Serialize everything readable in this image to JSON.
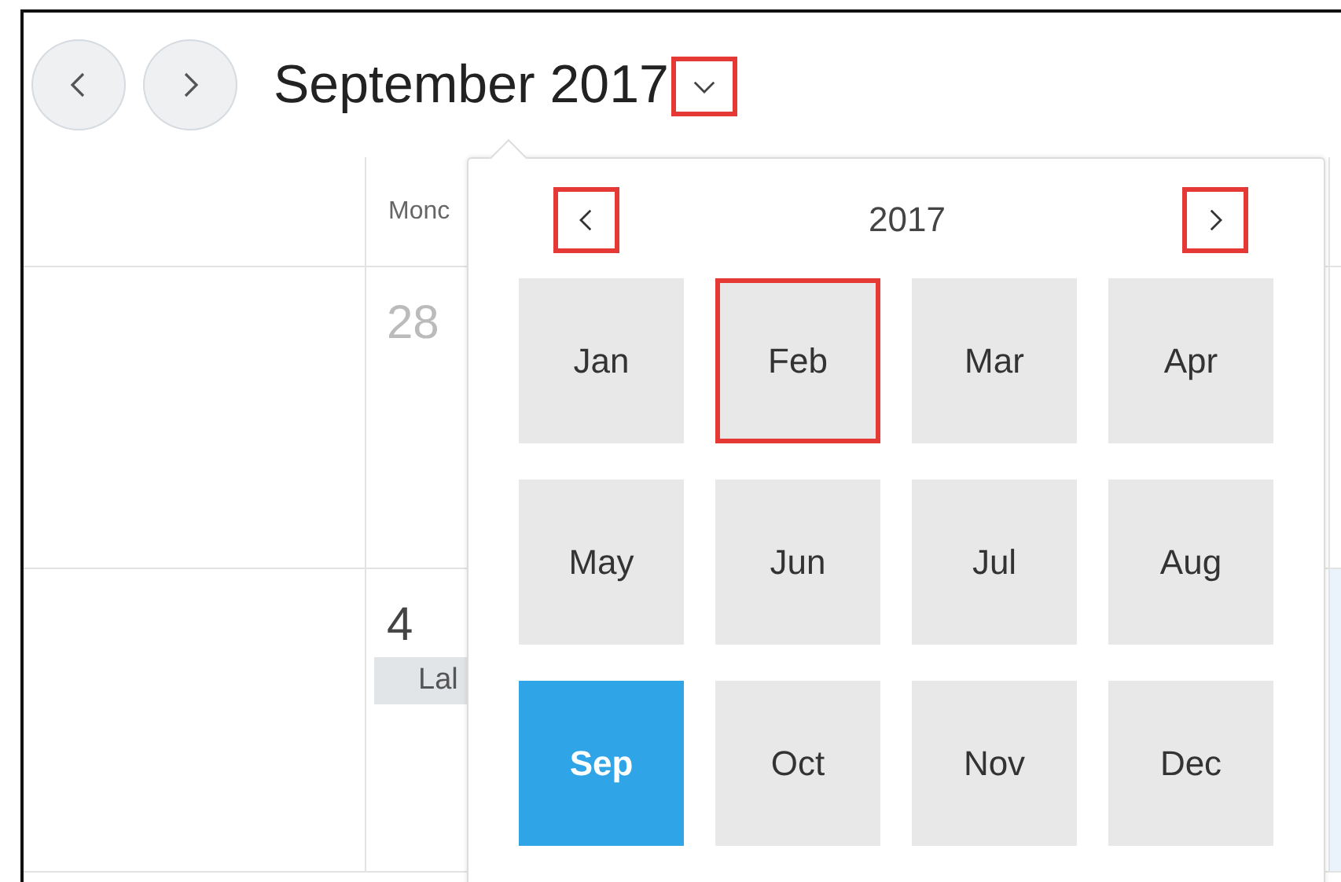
{
  "header": {
    "title": "September 2017",
    "dropdown_highlighted": true
  },
  "calendar": {
    "columns": [
      "Monc"
    ],
    "rows": [
      {
        "day": "28",
        "muted": true,
        "events": []
      },
      {
        "day": "4",
        "muted": false,
        "events": [
          "Lal"
        ]
      }
    ]
  },
  "month_picker": {
    "year": "2017",
    "prev_highlighted": true,
    "next_highlighted": true,
    "months": [
      {
        "label": "Jan",
        "selected": false,
        "highlighted": false
      },
      {
        "label": "Feb",
        "selected": false,
        "highlighted": true
      },
      {
        "label": "Mar",
        "selected": false,
        "highlighted": false
      },
      {
        "label": "Apr",
        "selected": false,
        "highlighted": false
      },
      {
        "label": "May",
        "selected": false,
        "highlighted": false
      },
      {
        "label": "Jun",
        "selected": false,
        "highlighted": false
      },
      {
        "label": "Jul",
        "selected": false,
        "highlighted": false
      },
      {
        "label": "Aug",
        "selected": false,
        "highlighted": false
      },
      {
        "label": "Sep",
        "selected": true,
        "highlighted": false
      },
      {
        "label": "Oct",
        "selected": false,
        "highlighted": false
      },
      {
        "label": "Nov",
        "selected": false,
        "highlighted": false
      },
      {
        "label": "Dec",
        "selected": false,
        "highlighted": false
      }
    ]
  }
}
